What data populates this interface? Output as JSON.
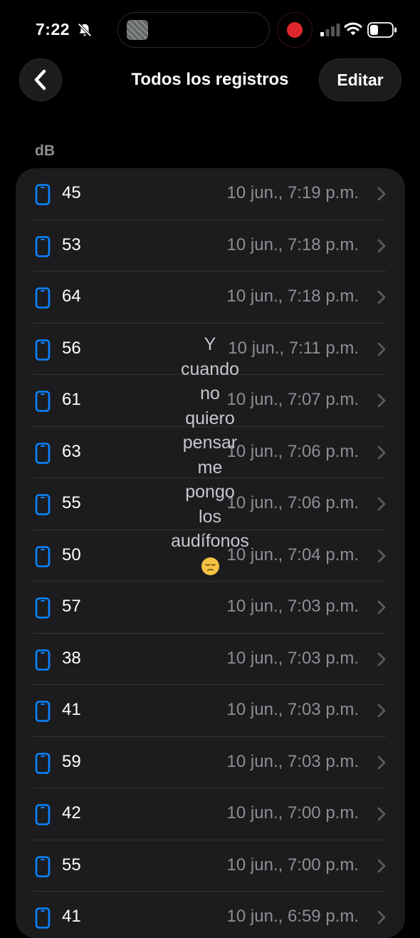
{
  "status_bar": {
    "time": "7:22"
  },
  "nav": {
    "title": "Todos los registros",
    "edit_label": "Editar"
  },
  "section": {
    "header": "dB"
  },
  "records": [
    {
      "value": "45",
      "date": "10 jun., 7:19 p.m."
    },
    {
      "value": "53",
      "date": "10 jun., 7:18 p.m."
    },
    {
      "value": "64",
      "date": "10 jun., 7:18 p.m."
    },
    {
      "value": "56",
      "date": "10 jun., 7:11 p.m."
    },
    {
      "value": "61",
      "date": "10 jun., 7:07 p.m."
    },
    {
      "value": "63",
      "date": "10 jun., 7:06 p.m."
    },
    {
      "value": "55",
      "date": "10 jun., 7:06 p.m."
    },
    {
      "value": "50",
      "date": "10 jun., 7:04 p.m."
    },
    {
      "value": "57",
      "date": "10 jun., 7:03 p.m."
    },
    {
      "value": "38",
      "date": "10 jun., 7:03 p.m."
    },
    {
      "value": "41",
      "date": "10 jun., 7:03 p.m."
    },
    {
      "value": "59",
      "date": "10 jun., 7:03 p.m."
    },
    {
      "value": "42",
      "date": "10 jun., 7:00 p.m."
    },
    {
      "value": "55",
      "date": "10 jun., 7:00 p.m."
    },
    {
      "value": "41",
      "date": "10 jun., 6:59 p.m."
    }
  ],
  "caption": {
    "text": "Y\ncuando\nno\nquiero\npensar\nme\npongo\nlos\naudífonos",
    "emoji": "pensive-face"
  },
  "colors": {
    "background": "#000000",
    "card": "#1c1c1e",
    "accent_blue": "#0a84ff",
    "secondary_text": "#8e8e93",
    "recording_red": "#e0282c"
  }
}
